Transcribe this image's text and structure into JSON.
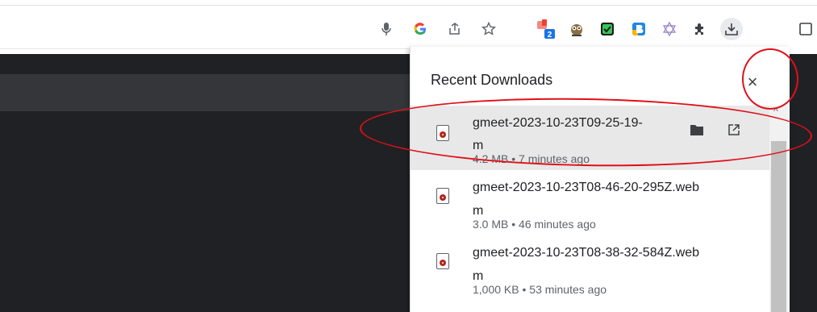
{
  "toolbar": {
    "icons": [
      "mic-icon",
      "google-icon",
      "share-icon",
      "star-icon",
      "extension-badge-icon",
      "owl-extension-icon",
      "checkbox-extension-icon",
      "b-extension-icon",
      "star-of-david-extension-icon",
      "puzzle-icon",
      "download-icon",
      "sidepanel-icon"
    ],
    "extension_badge_count": "2"
  },
  "downloads": {
    "title": "Recent Downloads",
    "close_label": "×",
    "items": [
      {
        "name_line1": "gmeet-2023-10-23T09-25-19-",
        "name_line2": "m",
        "meta": "4.2 MB • 7 minutes ago",
        "highlighted": true
      },
      {
        "name_line1": "gmeet-2023-10-23T08-46-20-295Z.web",
        "name_line2": "m",
        "meta": "3.0 MB • 46 minutes ago",
        "highlighted": false
      },
      {
        "name_line1": "gmeet-2023-10-23T08-38-32-584Z.web",
        "name_line2": "m",
        "meta": "1,000 KB • 53 minutes ago",
        "highlighted": false
      }
    ]
  },
  "colors": {
    "annotation": "#e0101a",
    "page_dark": "#202124",
    "highlight": "#e8e8e8"
  }
}
